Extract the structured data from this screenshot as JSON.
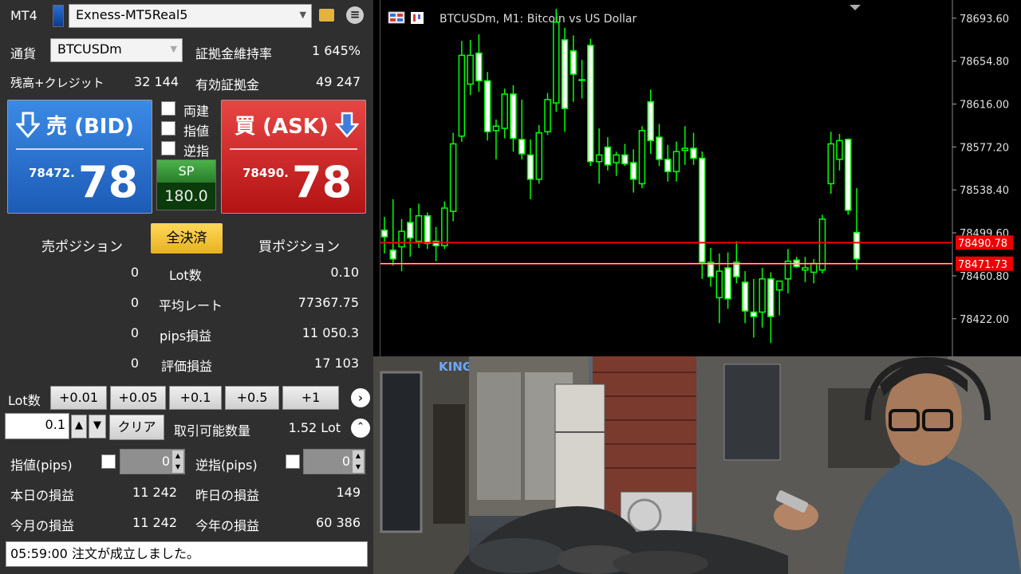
{
  "panel": {
    "platform": "MT4",
    "account": "Exness-MT5Real5",
    "currency_label": "通貨",
    "symbol": "BTCUSDm",
    "margin_level_label": "証拠金維持率",
    "margin_level": "1 645%",
    "balance_label": "残高+クレジット",
    "balance": "32 144",
    "equity_label": "有効証拠金",
    "equity": "49 247",
    "sell": {
      "label": "売 (BID)",
      "price_small": "78472.",
      "price_big": "78"
    },
    "buy": {
      "label": "買 (ASK)",
      "price_small": "78490.",
      "price_big": "78"
    },
    "options": [
      "両建",
      "指値",
      "逆指"
    ],
    "spread_label": "SP",
    "spread": "180.0",
    "sell_positions_label": "売ポジション",
    "close_all_label": "全決済",
    "buy_positions_label": "買ポジション",
    "stats": [
      {
        "sell": "0",
        "label": "Lot数",
        "buy": "0.10"
      },
      {
        "sell": "0",
        "label": "平均レート",
        "buy": "77367.75"
      },
      {
        "sell": "0",
        "label": "pips損益",
        "buy": "11 050.3"
      },
      {
        "sell": "0",
        "label": "評価損益",
        "buy": "17 103"
      }
    ],
    "lot_label": "Lot数",
    "lot_buttons": [
      "+0.01",
      "+0.05",
      "+0.1",
      "+0.5",
      "+1"
    ],
    "lot_value": "0.1",
    "clear_label": "クリア",
    "tradable_label": "取引可能数量",
    "tradable_value": "1.52 Lot",
    "limit_label": "指値(pips)",
    "limit_value": "0",
    "stop_label": "逆指(pips)",
    "stop_value": "0",
    "today_pl_label": "本日の損益",
    "today_pl": "11 242",
    "yesterday_pl_label": "昨日の損益",
    "yesterday_pl": "149",
    "month_pl_label": "今月の損益",
    "month_pl": "11 242",
    "year_pl_label": "今年の損益",
    "year_pl": "60 386",
    "status_message": "05:59:00 注文が成立しました。"
  },
  "chart_data": {
    "type": "candlestick",
    "title": "BTCUSDm, M1:  Bitcoin vs US Dollar",
    "y_ticks": [
      "78693.60",
      "78654.80",
      "78616.00",
      "78577.20",
      "78538.40",
      "78499.60",
      "78460.80",
      "78422.00"
    ],
    "ylim": [
      78388,
      78710
    ],
    "ask_line": 78490.78,
    "bid_line": 78471.73,
    "ask_label": "78490.78",
    "bid_label": "78471.73",
    "bull_color": "#00ff00",
    "bear_color": "#ffffff",
    "candles": [
      {
        "o": 78502,
        "h": 78514,
        "l": 78481,
        "c": 78496
      },
      {
        "o": 78484,
        "h": 78530,
        "l": 78470,
        "c": 78476
      },
      {
        "o": 78487,
        "h": 78512,
        "l": 78465,
        "c": 78501
      },
      {
        "o": 78509,
        "h": 78522,
        "l": 78478,
        "c": 78495
      },
      {
        "o": 78492,
        "h": 78526,
        "l": 78486,
        "c": 78515
      },
      {
        "o": 78515,
        "h": 78518,
        "l": 78485,
        "c": 78490
      },
      {
        "o": 78492,
        "h": 78505,
        "l": 78474,
        "c": 78488
      },
      {
        "o": 78488,
        "h": 78528,
        "l": 78485,
        "c": 78522
      },
      {
        "o": 78519,
        "h": 78590,
        "l": 78510,
        "c": 78580
      },
      {
        "o": 78587,
        "h": 78673,
        "l": 78582,
        "c": 78660
      },
      {
        "o": 78634,
        "h": 78674,
        "l": 78624,
        "c": 78660
      },
      {
        "o": 78662,
        "h": 78679,
        "l": 78627,
        "c": 78637
      },
      {
        "o": 78637,
        "h": 78645,
        "l": 78583,
        "c": 78591
      },
      {
        "o": 78592,
        "h": 78602,
        "l": 78566,
        "c": 78596
      },
      {
        "o": 78594,
        "h": 78630,
        "l": 78585,
        "c": 78625
      },
      {
        "o": 78625,
        "h": 78633,
        "l": 78573,
        "c": 78585
      },
      {
        "o": 78584,
        "h": 78620,
        "l": 78566,
        "c": 78571
      },
      {
        "o": 78570,
        "h": 78584,
        "l": 78530,
        "c": 78548
      },
      {
        "o": 78548,
        "h": 78597,
        "l": 78544,
        "c": 78590
      },
      {
        "o": 78591,
        "h": 78626,
        "l": 78588,
        "c": 78620
      },
      {
        "o": 78617,
        "h": 78702,
        "l": 78609,
        "c": 78690
      },
      {
        "o": 78674,
        "h": 78685,
        "l": 78591,
        "c": 78612
      },
      {
        "o": 78664,
        "h": 78678,
        "l": 78618,
        "c": 78643
      },
      {
        "o": 78638,
        "h": 78656,
        "l": 78621,
        "c": 78638
      },
      {
        "o": 78669,
        "h": 78675,
        "l": 78560,
        "c": 78564
      },
      {
        "o": 78564,
        "h": 78594,
        "l": 78544,
        "c": 78570
      },
      {
        "o": 78577,
        "h": 78586,
        "l": 78556,
        "c": 78561
      },
      {
        "o": 78563,
        "h": 78573,
        "l": 78551,
        "c": 78570
      },
      {
        "o": 78570,
        "h": 78580,
        "l": 78560,
        "c": 78562
      },
      {
        "o": 78563,
        "h": 78575,
        "l": 78536,
        "c": 78548
      },
      {
        "o": 78544,
        "h": 78596,
        "l": 78540,
        "c": 78592
      },
      {
        "o": 78618,
        "h": 78629,
        "l": 78571,
        "c": 78583
      },
      {
        "o": 78586,
        "h": 78598,
        "l": 78560,
        "c": 78566
      },
      {
        "o": 78566,
        "h": 78579,
        "l": 78546,
        "c": 78555
      },
      {
        "o": 78555,
        "h": 78582,
        "l": 78546,
        "c": 78573
      },
      {
        "o": 78574,
        "h": 78596,
        "l": 78561,
        "c": 78576
      },
      {
        "o": 78576,
        "h": 78590,
        "l": 78561,
        "c": 78567
      },
      {
        "o": 78567,
        "h": 78573,
        "l": 78458,
        "c": 78473
      },
      {
        "o": 78473,
        "h": 78486,
        "l": 78451,
        "c": 78460
      },
      {
        "o": 78441,
        "h": 78481,
        "l": 78418,
        "c": 78465
      },
      {
        "o": 78468,
        "h": 78482,
        "l": 78431,
        "c": 78440
      },
      {
        "o": 78473,
        "h": 78492,
        "l": 78454,
        "c": 78460
      },
      {
        "o": 78455,
        "h": 78465,
        "l": 78418,
        "c": 78429
      },
      {
        "o": 78428,
        "h": 78458,
        "l": 78405,
        "c": 78424
      },
      {
        "o": 78428,
        "h": 78468,
        "l": 78414,
        "c": 78458
      },
      {
        "o": 78458,
        "h": 78464,
        "l": 78400,
        "c": 78424
      },
      {
        "o": 78448,
        "h": 78456,
        "l": 78425,
        "c": 78456
      },
      {
        "o": 78458,
        "h": 78485,
        "l": 78445,
        "c": 78474
      },
      {
        "o": 78475,
        "h": 78478,
        "l": 78468,
        "c": 78469
      },
      {
        "o": 78466,
        "h": 78478,
        "l": 78455,
        "c": 78468
      },
      {
        "o": 78464,
        "h": 78476,
        "l": 78454,
        "c": 78472
      },
      {
        "o": 78466,
        "h": 78516,
        "l": 78463,
        "c": 78512
      },
      {
        "o": 78544,
        "h": 78591,
        "l": 78535,
        "c": 78580
      },
      {
        "o": 78566,
        "h": 78589,
        "l": 78556,
        "c": 78583
      },
      {
        "o": 78584,
        "h": 78585,
        "l": 78516,
        "c": 78520
      },
      {
        "o": 78500,
        "h": 78540,
        "l": 78466,
        "c": 78476
      }
    ]
  },
  "scene": {
    "sign_text": "KING"
  }
}
